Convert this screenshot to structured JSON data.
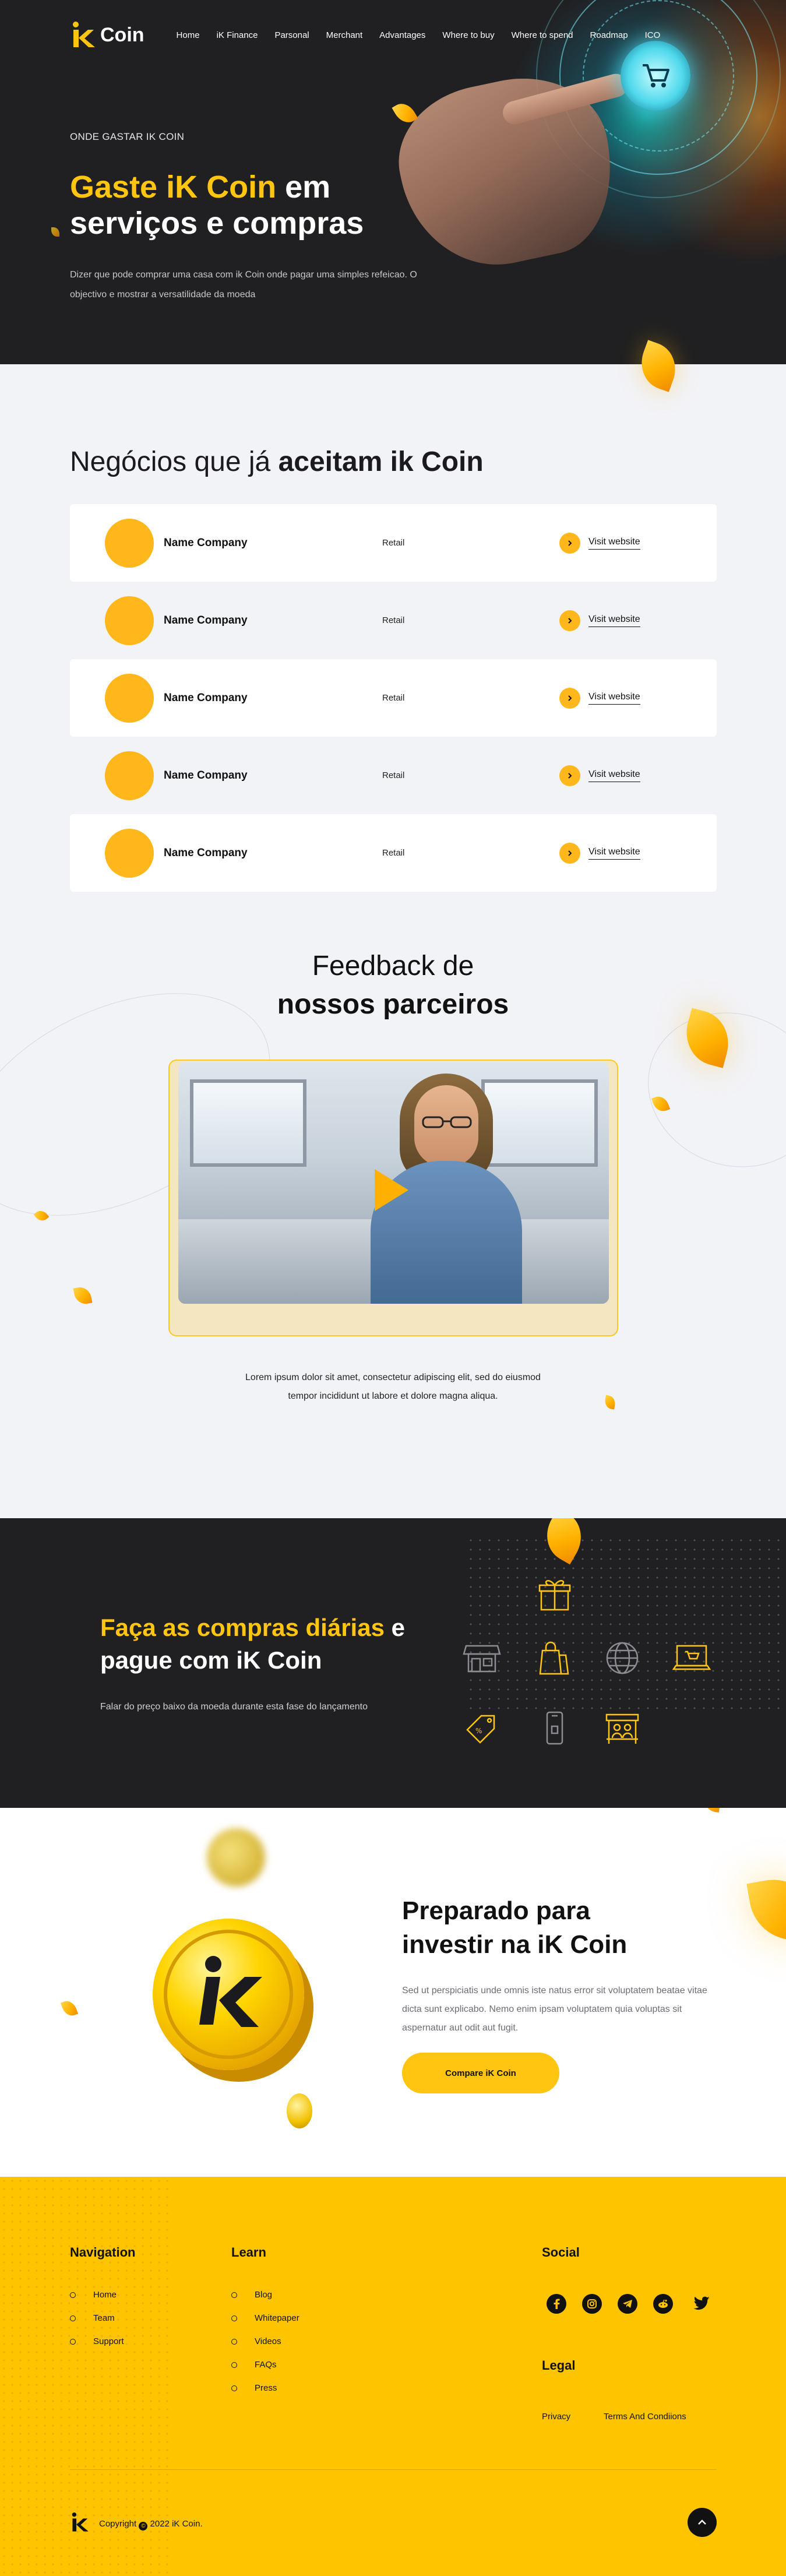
{
  "brand": {
    "name": "Coin",
    "accent": "#ffc510",
    "dark": "#202022",
    "footer_bg": "#ffc400"
  },
  "nav": {
    "items": [
      "Home",
      "iK Finance",
      "Parsonal",
      "Merchant",
      "Advantages",
      "Where to buy",
      "Where to spend",
      "Roadmap",
      "ICO"
    ]
  },
  "hero": {
    "eyebrow": "ONDE GASTAR IK COIN",
    "title_highlight": "Gaste iK Coin",
    "title_rest": " em serviços e compras",
    "subtitle": "Dizer que pode comprar uma casa com ik Coin onde pagar uma simples refeicao. O objectivo e mostrar a versatilidade da moeda"
  },
  "businesses": {
    "title_prefix": "Negócios que já ",
    "title_bold": "aceitam ik Coin",
    "rows": [
      {
        "name": "Name Company",
        "category": "Retail",
        "link": "Visit website"
      },
      {
        "name": "Name Company",
        "category": "Retail",
        "link": "Visit website"
      },
      {
        "name": "Name Company",
        "category": "Retail",
        "link": "Visit website"
      },
      {
        "name": "Name Company",
        "category": "Retail",
        "link": "Visit website"
      },
      {
        "name": "Name Company",
        "category": "Retail",
        "link": "Visit website"
      }
    ]
  },
  "feedback": {
    "title_line1": "Feedback de",
    "title_line2": "nossos parceiros",
    "text_line1": "Lorem ipsum dolor sit amet, consectetur adipiscing elit, sed do eiusmod",
    "text_line2": "tempor incididunt ut labore et dolore magna aliqua."
  },
  "daily": {
    "title_highlight": "Faça as compras diárias",
    "title_rest": " e pague com iK Coin",
    "subtitle": "Falar do preço baixo da moeda durante esta fase do lançamento",
    "icons": [
      "gift-icon",
      "store-icon",
      "shopping-bag-icon",
      "globe-icon",
      "laptop-cart-icon",
      "discount-tag-icon",
      "mobile-pay-icon",
      "market-stall-icon"
    ]
  },
  "invest": {
    "title": "Preparado para investir na iK Coin",
    "text": "Sed ut perspiciatis unde omnis iste natus error sit voluptatem beatae vitae dicta sunt explicabo. Nemo enim ipsam voluptatem quia voluptas sit aspernatur aut odit aut fugit.",
    "button": "Compare iK Coin"
  },
  "footer": {
    "navigation": {
      "title": "Navigation",
      "links": [
        "Home",
        "Team",
        "Support"
      ]
    },
    "learn": {
      "title": "Learn",
      "links": [
        "Blog",
        "Whitepaper",
        "Videos",
        "FAQs",
        "Press"
      ]
    },
    "social": {
      "title": "Social",
      "icons": [
        "facebook-icon",
        "instagram-icon",
        "telegram-icon",
        "reddit-icon",
        "twitter-icon"
      ]
    },
    "legal": {
      "title": "Legal",
      "links": [
        "Privacy",
        "Terms And Condiions"
      ]
    },
    "copyright_prefix": "Copyright",
    "copyright_suffix": "2022 iK Coin."
  }
}
